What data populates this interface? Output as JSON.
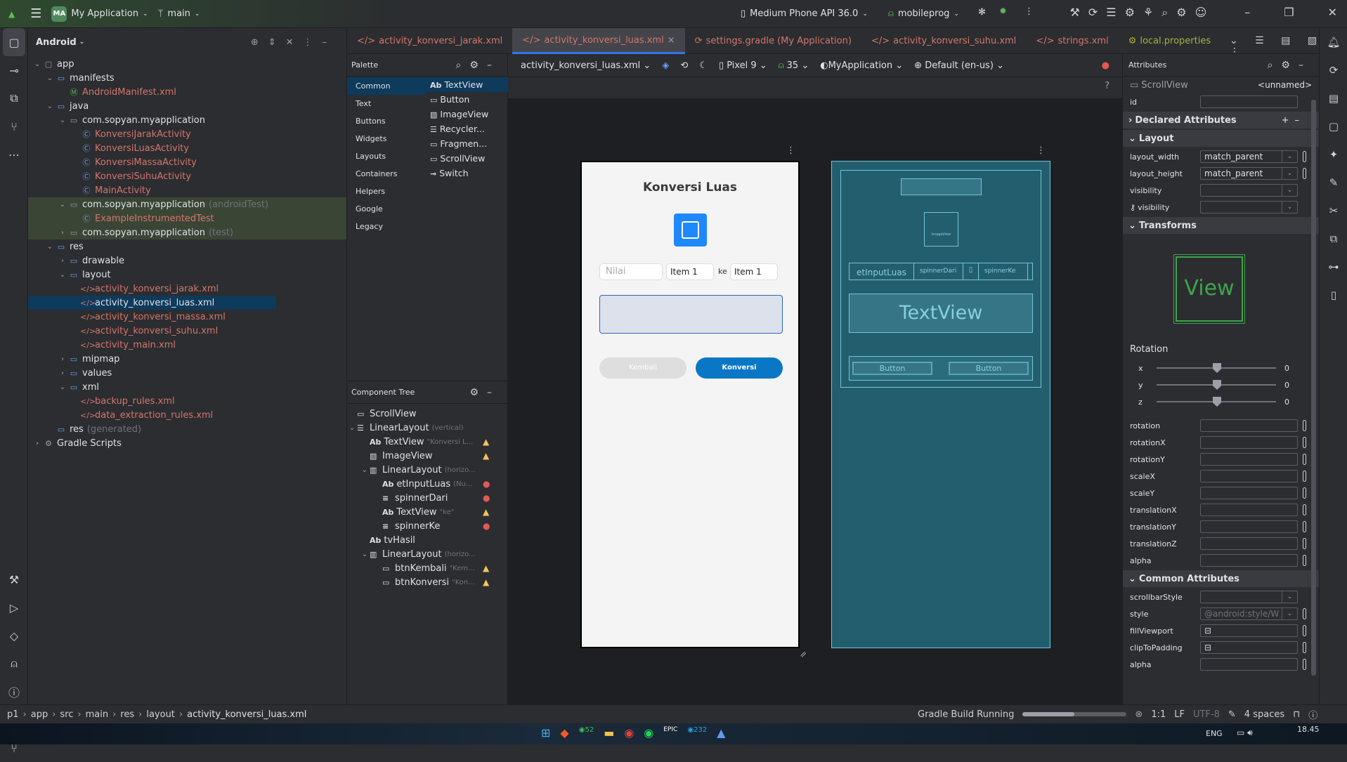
{
  "titlebar": {
    "project_badge": "MA",
    "project": "My Application",
    "branch": "main",
    "device": "Medium Phone API 36.0",
    "run_config": "mobileprog"
  },
  "project_panel": {
    "title": "Android",
    "items": [
      {
        "label": "app",
        "level": 0,
        "arrow": "v",
        "icon": "module",
        "kind": "normal"
      },
      {
        "label": "manifests",
        "level": 1,
        "arrow": "v",
        "icon": "folder",
        "kind": "normal"
      },
      {
        "label": "AndroidManifest.xml",
        "level": 2,
        "arrow": "",
        "icon": "manifest",
        "kind": "red"
      },
      {
        "label": "java",
        "level": 1,
        "arrow": "v",
        "icon": "folder",
        "kind": "normal"
      },
      {
        "label": "com.sopyan.myapplication",
        "level": 2,
        "arrow": "v",
        "icon": "package",
        "kind": "normal"
      },
      {
        "label": "KonversiJarakActivity",
        "level": 3,
        "arrow": "",
        "icon": "class",
        "kind": "red"
      },
      {
        "label": "KonversiLuasActivity",
        "level": 3,
        "arrow": "",
        "icon": "class",
        "kind": "red"
      },
      {
        "label": "KonversiMassaActivity",
        "level": 3,
        "arrow": "",
        "icon": "class",
        "kind": "red"
      },
      {
        "label": "KonversiSuhuActivity",
        "level": 3,
        "arrow": "",
        "icon": "class",
        "kind": "red"
      },
      {
        "label": "MainActivity",
        "level": 3,
        "arrow": "",
        "icon": "class",
        "kind": "red"
      },
      {
        "label": "com.sopyan.myapplication",
        "suffix": "(androidTest)",
        "level": 2,
        "arrow": "v",
        "icon": "package",
        "kind": "test"
      },
      {
        "label": "ExampleInstrumentedTest",
        "level": 3,
        "arrow": "",
        "icon": "class",
        "kind": "testred"
      },
      {
        "label": "com.sopyan.myapplication",
        "suffix": "(test)",
        "level": 2,
        "arrow": ">",
        "icon": "package",
        "kind": "test"
      },
      {
        "label": "res",
        "level": 1,
        "arrow": "v",
        "icon": "folder",
        "kind": "normal"
      },
      {
        "label": "drawable",
        "level": 2,
        "arrow": ">",
        "icon": "folder",
        "kind": "normal"
      },
      {
        "label": "layout",
        "level": 2,
        "arrow": "v",
        "icon": "folder",
        "kind": "normal"
      },
      {
        "label": "activity_konversi_jarak.xml",
        "level": 3,
        "arrow": "",
        "icon": "xml",
        "kind": "red"
      },
      {
        "label": "activity_konversi_luas.xml",
        "level": 3,
        "arrow": "",
        "icon": "xml",
        "kind": "selected"
      },
      {
        "label": "activity_konversi_massa.xml",
        "level": 3,
        "arrow": "",
        "icon": "xml",
        "kind": "red"
      },
      {
        "label": "activity_konversi_suhu.xml",
        "level": 3,
        "arrow": "",
        "icon": "xml",
        "kind": "red"
      },
      {
        "label": "activity_main.xml",
        "level": 3,
        "arrow": "",
        "icon": "xml",
        "kind": "red"
      },
      {
        "label": "mipmap",
        "level": 2,
        "arrow": ">",
        "icon": "folder",
        "kind": "normal"
      },
      {
        "label": "values",
        "level": 2,
        "arrow": ">",
        "icon": "folder",
        "kind": "normal"
      },
      {
        "label": "xml",
        "level": 2,
        "arrow": "v",
        "icon": "folder",
        "kind": "normal"
      },
      {
        "label": "backup_rules.xml",
        "level": 3,
        "arrow": "",
        "icon": "xml",
        "kind": "red"
      },
      {
        "label": "data_extraction_rules.xml",
        "level": 3,
        "arrow": "",
        "icon": "xml",
        "kind": "red"
      },
      {
        "label": "res",
        "suffix": "(generated)",
        "level": 1,
        "arrow": "",
        "icon": "folder",
        "kind": "normal"
      },
      {
        "label": "Gradle Scripts",
        "level": 0,
        "arrow": ">",
        "icon": "gradle",
        "kind": "normal"
      }
    ]
  },
  "tabs": [
    {
      "label": "activity_konversi_jarak.xml",
      "icon": "</>",
      "active": false,
      "color": "#d5756c"
    },
    {
      "label": "activity_konversi_luas.xml",
      "icon": "</>",
      "active": true,
      "color": "#d5756c"
    },
    {
      "label": "settings.gradle (My Application)",
      "icon": "gradle",
      "active": false,
      "color": "#d5756c"
    },
    {
      "label": "activity_konversi_suhu.xml",
      "icon": "</>",
      "active": false,
      "color": "#d5756c"
    },
    {
      "label": "strings.xml",
      "icon": "</>",
      "active": false,
      "color": "#d5756c"
    },
    {
      "label": "local.properties",
      "icon": "gear",
      "active": false,
      "color": "#a8b33a"
    }
  ],
  "palette": {
    "title": "Palette",
    "categories": [
      "Common",
      "Text",
      "Buttons",
      "Widgets",
      "Layouts",
      "Containers",
      "Helpers",
      "Google",
      "Legacy"
    ],
    "items": [
      {
        "icon": "Ab",
        "label": "TextView"
      },
      {
        "icon": "▭",
        "label": "Button"
      },
      {
        "icon": "▨",
        "label": "ImageView"
      },
      {
        "icon": "☰",
        "label": "Recycler..."
      },
      {
        "icon": "▭",
        "label": "Fragmen..."
      },
      {
        "icon": "▭",
        "label": "ScrollView"
      },
      {
        "icon": "⊸",
        "label": "Switch"
      }
    ]
  },
  "component_tree": {
    "title": "Component Tree",
    "items": [
      {
        "level": 0,
        "arrow": "",
        "icon": "▭",
        "label": "ScrollView",
        "hint": "",
        "status": ""
      },
      {
        "level": 0,
        "arrow": "v",
        "icon": "☰",
        "label": "LinearLayout",
        "hint": "(vertical)",
        "status": ""
      },
      {
        "level": 1,
        "arrow": "",
        "icon": "Ab",
        "label": "TextView",
        "hint": "\"Konversi L...",
        "status": "warn"
      },
      {
        "level": 1,
        "arrow": "",
        "icon": "▨",
        "label": "ImageView",
        "hint": "",
        "status": "warn"
      },
      {
        "level": 1,
        "arrow": "v",
        "icon": "▥",
        "label": "LinearLayout",
        "hint": "(horizo...",
        "status": ""
      },
      {
        "level": 2,
        "arrow": "",
        "icon": "Ab",
        "label": "etInputLuas",
        "hint": "(Nu...",
        "status": "error"
      },
      {
        "level": 2,
        "arrow": "",
        "icon": "≡",
        "label": "spinnerDari",
        "hint": "",
        "status": "error"
      },
      {
        "level": 2,
        "arrow": "",
        "icon": "Ab",
        "label": "TextView",
        "hint": "\"ke\"",
        "status": "warn"
      },
      {
        "level": 2,
        "arrow": "",
        "icon": "≡",
        "label": "spinnerKe",
        "hint": "",
        "status": "error"
      },
      {
        "level": 1,
        "arrow": "",
        "icon": "Ab",
        "label": "tvHasil",
        "hint": "",
        "status": ""
      },
      {
        "level": 1,
        "arrow": "v",
        "icon": "▥",
        "label": "LinearLayout",
        "hint": "(horizo...",
        "status": ""
      },
      {
        "level": 2,
        "arrow": "",
        "icon": "▭",
        "label": "btnKembali",
        "hint": "\"Kem...",
        "status": "warn"
      },
      {
        "level": 2,
        "arrow": "",
        "icon": "▭",
        "label": "btnKonversi",
        "hint": "\"Kon...",
        "status": "warn"
      }
    ]
  },
  "design_toolbar": {
    "file": "activity_konversi_luas.xml",
    "device": "Pixel 9",
    "api": "35",
    "theme": "MyApplication",
    "locale": "Default (en-us)",
    "help": "?"
  },
  "preview": {
    "title": "Konversi Luas",
    "input_placeholder": "Nilai",
    "spinner_from": "Item 1",
    "ke": "ke",
    "spinner_to": "Item 1",
    "btn_back": "Kembali",
    "btn_convert": "Konversi",
    "accent": "#0a77c6"
  },
  "blueprint": {
    "imageview": "ImageView",
    "input": "etInputLuas",
    "spinner_from": "spinnerDari",
    "spinner_to": "spinnerKe",
    "textview": "TextView",
    "button1": "Button",
    "button2": "Button"
  },
  "attributes": {
    "title": "Attributes",
    "component": "ScrollView",
    "name": "<unnamed>",
    "id_label": "id",
    "declared": "Declared Attributes",
    "layout": "Layout",
    "transforms": "Transforms",
    "common": "Common Attributes",
    "layout_rows": [
      {
        "label": "layout_width",
        "value": "match_parent",
        "dropdown": true,
        "pin": true
      },
      {
        "label": "layout_height",
        "value": "match_parent",
        "dropdown": true,
        "pin": true
      },
      {
        "label": "visibility",
        "value": "",
        "dropdown": true,
        "pin": false
      },
      {
        "label": "visibility",
        "value": "",
        "dropdown": true,
        "pin": false,
        "tool": true
      }
    ],
    "view_label": "View",
    "rotation_title": "Rotation",
    "sliders": [
      {
        "axis": "x",
        "value": "0"
      },
      {
        "axis": "y",
        "value": "0"
      },
      {
        "axis": "z",
        "value": "0"
      }
    ],
    "transform_rows": [
      "rotation",
      "rotationX",
      "rotationY",
      "scaleX",
      "scaleY",
      "translationX",
      "translationY",
      "translationZ",
      "alpha"
    ],
    "common_rows": [
      {
        "label": "scrollbarStyle",
        "value": "",
        "dropdown": true,
        "pin": false
      },
      {
        "label": "style",
        "value": "@android:style/W",
        "dropdown": true,
        "pin": true
      },
      {
        "label": "fillViewport",
        "value": "checkbox",
        "pin": true
      },
      {
        "label": "clipToPadding",
        "value": "checkbox",
        "pin": true
      },
      {
        "label": "alpha",
        "value": "",
        "pin": true
      }
    ]
  },
  "status": {
    "breadcrumb": [
      "p1",
      "app",
      "src",
      "main",
      "res",
      "layout",
      "activity_konversi_luas.xml"
    ],
    "task": "Gradle Build Running",
    "progress": 0.5,
    "position": "1:1",
    "line_sep": "LF",
    "encoding": "UTF-8",
    "indent": "4 spaces"
  },
  "taskbar": {
    "lang": "ENG",
    "time": "18.45",
    "badge1": "52",
    "badge2": "232"
  }
}
